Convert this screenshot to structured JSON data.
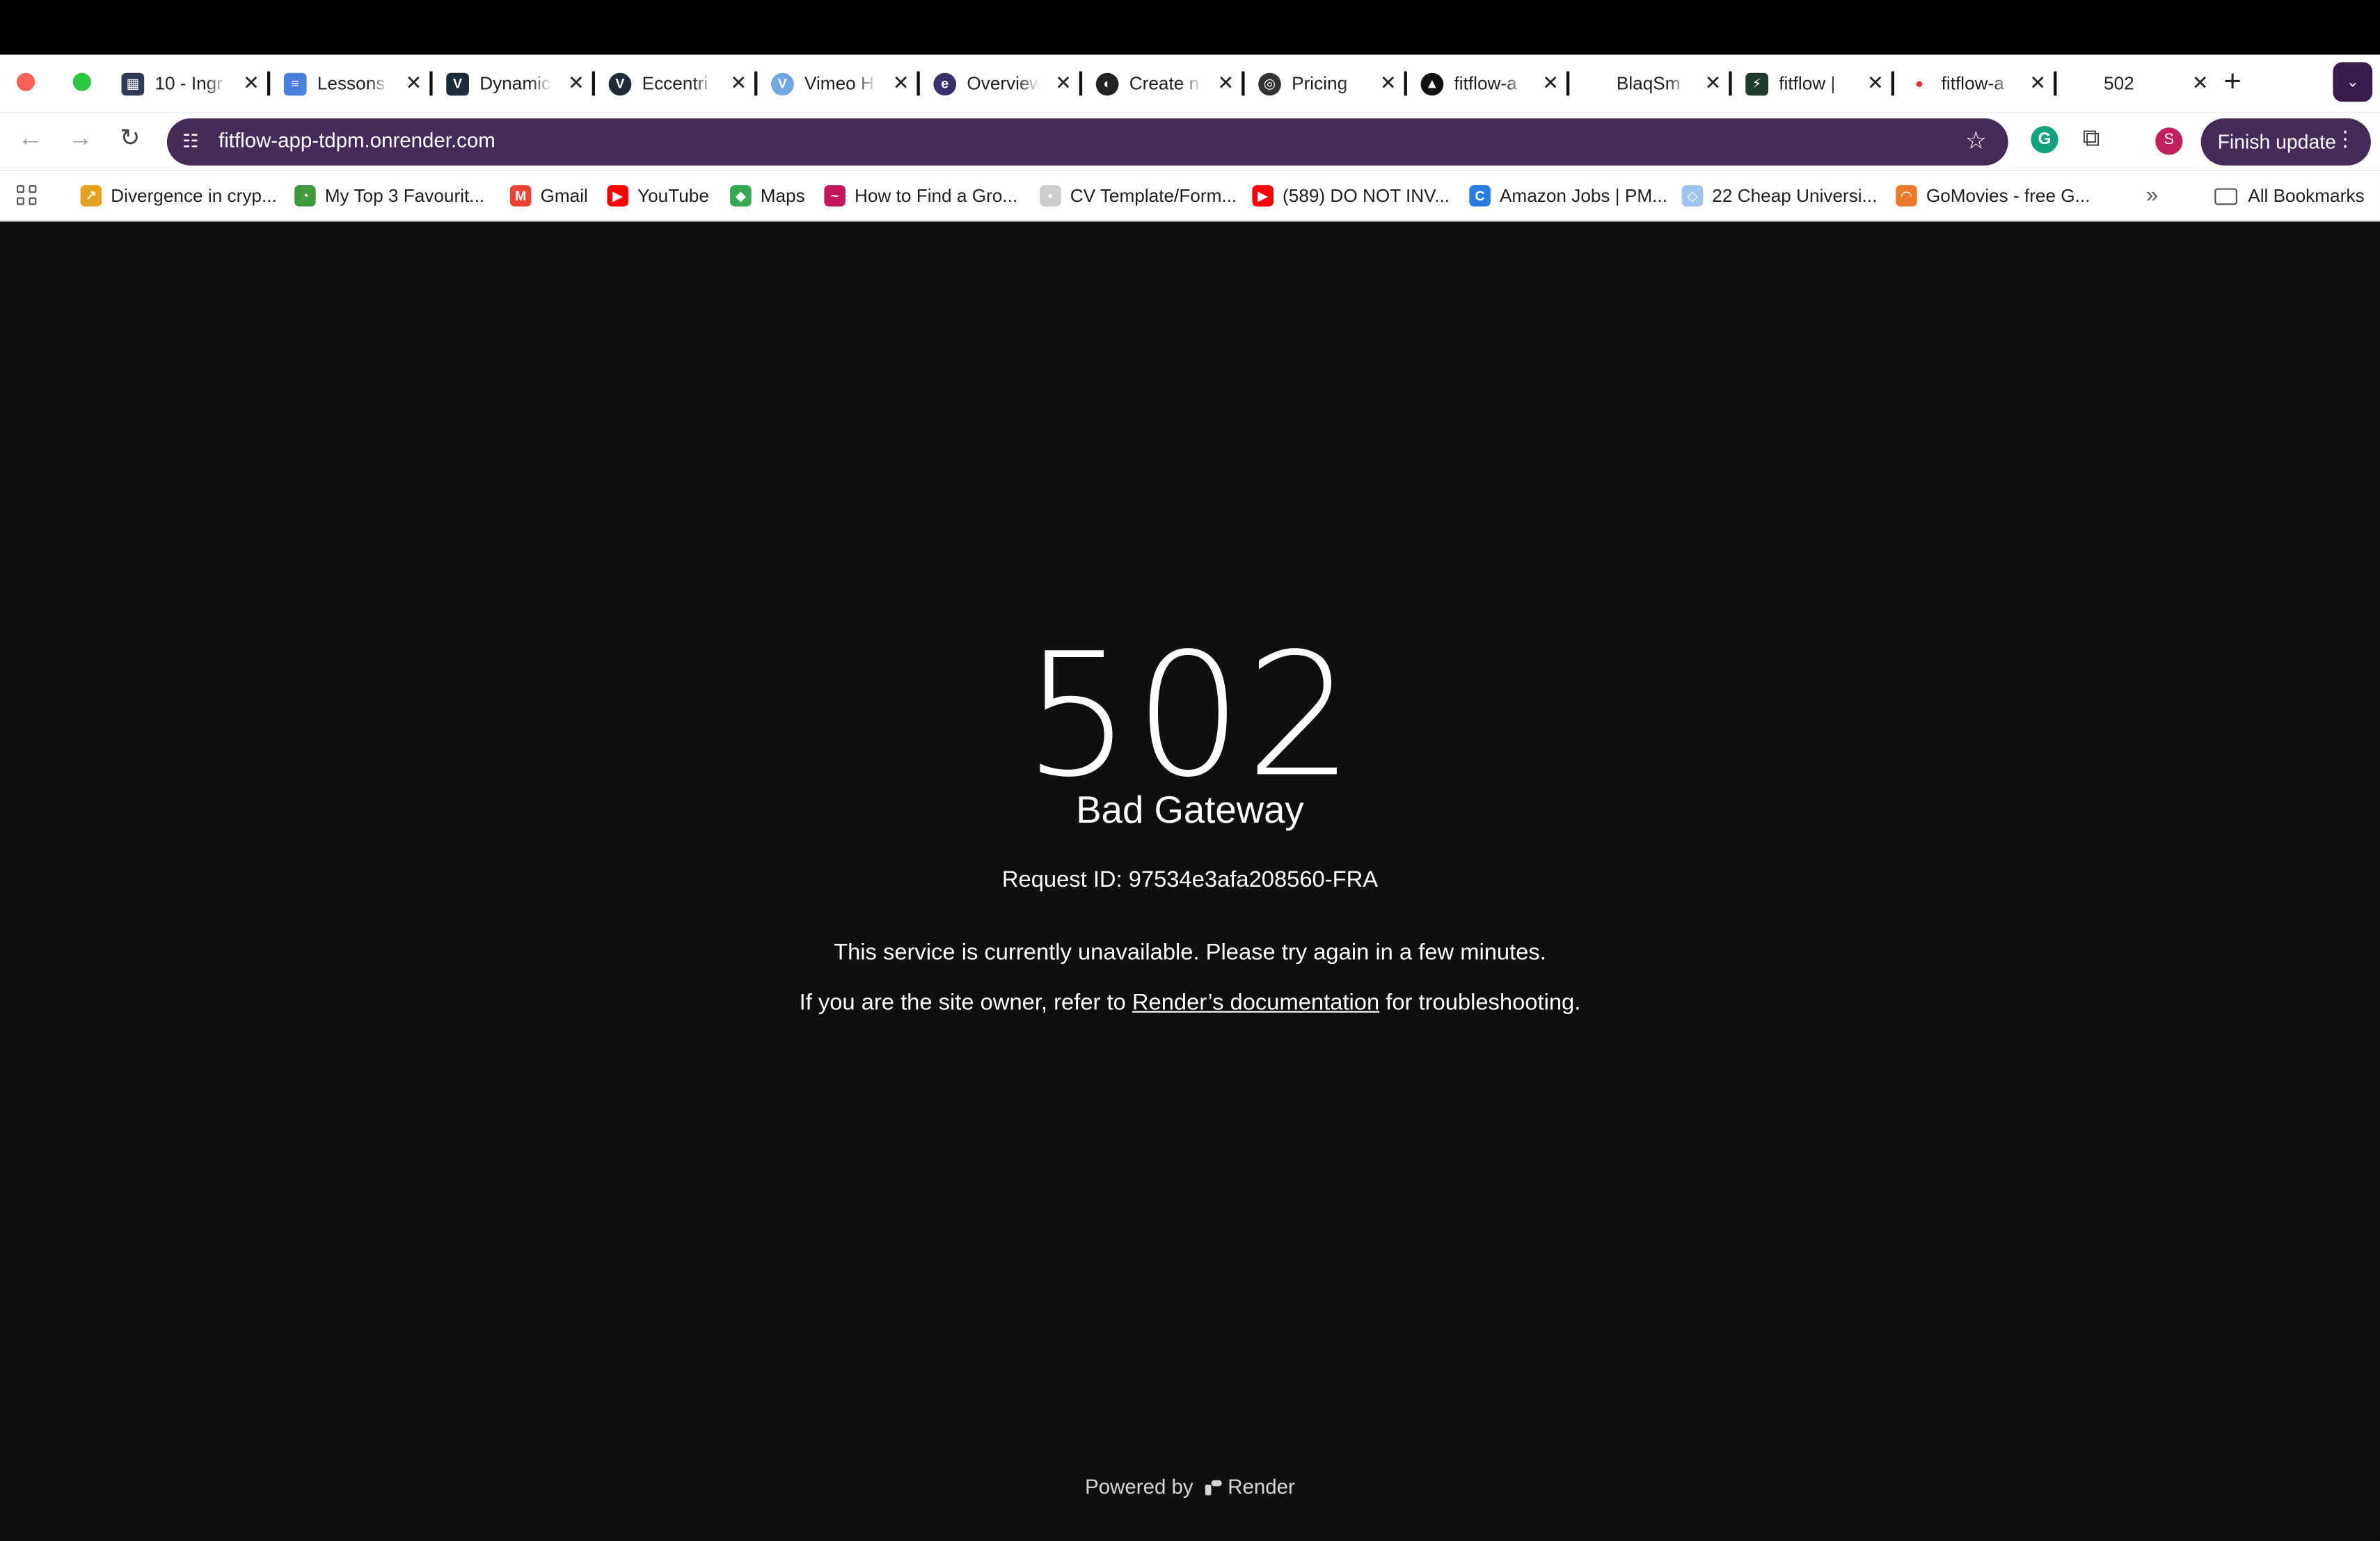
{
  "browser": {
    "tabs": [
      {
        "title": "10 - Ingr",
        "fav_color": "#2f3c55",
        "fav_glyph": "▦"
      },
      {
        "title": "Lessons",
        "fav_color": "#4a7fe0",
        "fav_glyph": "≡"
      },
      {
        "title": "Dynamic",
        "fav_color": "#1a2b3c",
        "fav_glyph": "V"
      },
      {
        "title": "Eccentri",
        "fav_color": "#1e2a3a",
        "fav_glyph": "V"
      },
      {
        "title": "Vimeo H",
        "fav_color": "#6fa7e0",
        "fav_glyph": "V"
      },
      {
        "title": "Overview",
        "fav_color": "#3a2f6b",
        "fav_glyph": "e"
      },
      {
        "title": "Create n",
        "fav_color": "#222222",
        "fav_glyph": "◐"
      },
      {
        "title": "Pricing",
        "fav_color": "#333333",
        "fav_glyph": "◎"
      },
      {
        "title": "fitflow-a",
        "fav_color": "#111111",
        "fav_glyph": "▲"
      },
      {
        "title": "BlaqSm",
        "fav_color": "#ffffff",
        "fav_glyph": ""
      },
      {
        "title": "fitflow |",
        "fav_color": "#1f3b2d",
        "fav_glyph": "⚡"
      },
      {
        "title": "fitflow-a",
        "fav_color": "#ffffff",
        "fav_glyph": "●"
      },
      {
        "title": "502",
        "fav_color": "#ffffff",
        "fav_glyph": ""
      }
    ],
    "new_tab": "+",
    "url": "fitflow-app-tdpm.onrender.com",
    "profile_initial": "S",
    "finish_update": "Finish update",
    "bookmarks": [
      {
        "label": "Divergence in cryp...",
        "fav_color": "#e8a020",
        "fav_glyph": "↗"
      },
      {
        "label": "My Top 3 Favourit...",
        "fav_color": "#3d9a3d",
        "fav_glyph": "◔"
      },
      {
        "label": "Gmail",
        "fav_color": "#ea4335",
        "fav_glyph": "M"
      },
      {
        "label": "YouTube",
        "fav_color": "#ff0000",
        "fav_glyph": "▶"
      },
      {
        "label": "Maps",
        "fav_color": "#34a853",
        "fav_glyph": "◆"
      },
      {
        "label": "How to Find a Gro...",
        "fav_color": "#c2185b",
        "fav_glyph": "~"
      },
      {
        "label": "CV Template/Form...",
        "fav_color": "#cccccc",
        "fav_glyph": "•"
      },
      {
        "label": "(589) DO NOT INV...",
        "fav_color": "#ff0000",
        "fav_glyph": "▶"
      },
      {
        "label": "Amazon Jobs | PM...",
        "fav_color": "#2a7de1",
        "fav_glyph": "C"
      },
      {
        "label": "22 Cheap Universi...",
        "fav_color": "#9cc4ef",
        "fav_glyph": "◇"
      },
      {
        "label": "GoMovies - free G...",
        "fav_color": "#e87a2a",
        "fav_glyph": "◠"
      }
    ],
    "all_bookmarks": "All Bookmarks"
  },
  "page": {
    "code": "502",
    "status": "Bad Gateway",
    "request_id": "Request ID: 97534e3afa208560-FRA",
    "message": "This service is currently unavailable. Please try again in a few minutes.",
    "owner_prefix": "If you are the site owner, refer to ",
    "docs_link": "Render’s documentation",
    "owner_suffix": " for troubleshooting.",
    "powered_by": "Powered by",
    "brand": "Render"
  }
}
